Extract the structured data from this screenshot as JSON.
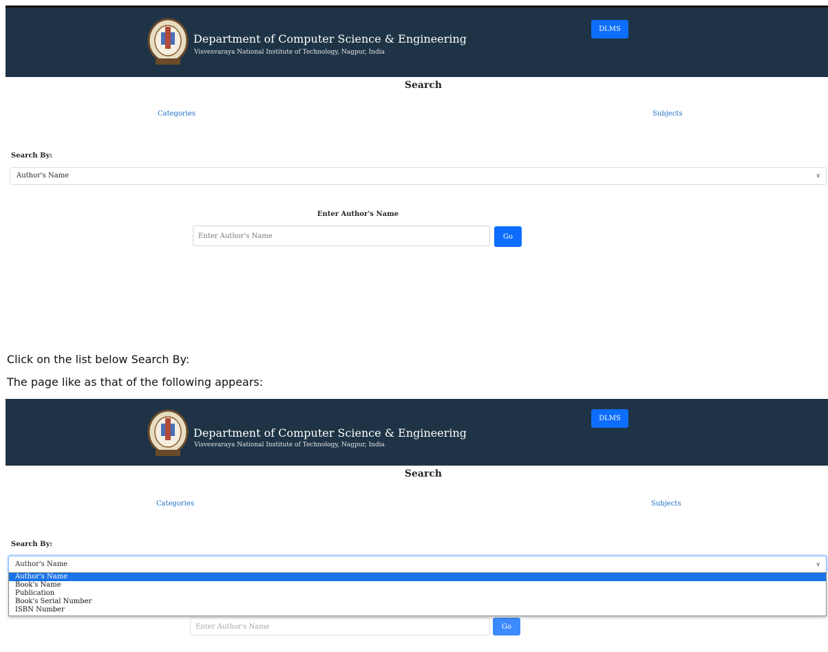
{
  "header": {
    "department": "Department of Computer Science & Engineering",
    "institute": "Visvesvaraya National Institute of Technology, Nagpur, India",
    "dlms_label": "DLMS"
  },
  "page": {
    "title": "Search",
    "categories_link": "Categories",
    "subjects_link": "Subjects",
    "search_by_label": "Search By:",
    "selected_option": "Author's Name",
    "enter_label": "Enter Author's Name",
    "input_placeholder": "Enter Author's Name",
    "go_label": "Go"
  },
  "dropdown_options": [
    "Author's Name",
    "Book's Name",
    "Publication",
    "Book's Serial Number",
    "ISBN Number"
  ],
  "instructions": {
    "line1": "Click on the list below Search By:",
    "line2": "The page like as that of the following appears:"
  },
  "colors": {
    "banner": "#1e3446",
    "primary_button": "#0d6efd",
    "link": "#1b6ec2",
    "selected_option_bg": "#1a73e8"
  }
}
